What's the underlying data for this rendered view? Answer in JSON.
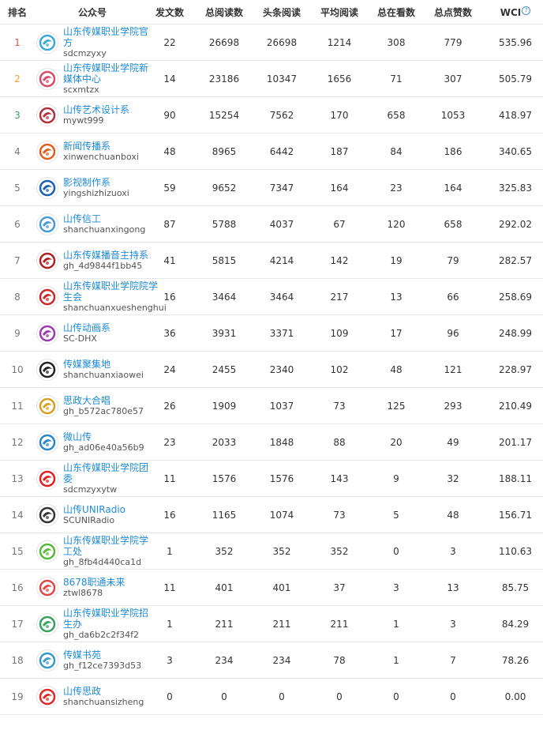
{
  "columns": {
    "rank": "排名",
    "account": "公众号",
    "posts": "发文数",
    "total_reads": "总阅读数",
    "headline_reads": "头条阅读",
    "avg_reads": "平均阅读",
    "total_watching": "总在看数",
    "total_likes": "总点赞数",
    "wci": "WCI",
    "wci_help_icon": "?"
  },
  "rows": [
    {
      "rank": "1",
      "title": "山东传媒职业学院官方",
      "id": "sdcmzyxy",
      "posts": "22",
      "total_reads": "26698",
      "headline_reads": "26698",
      "avg_reads": "1214",
      "total_watching": "308",
      "total_likes": "779",
      "wci": "535.96",
      "icon": "swirl-logo-icon",
      "color": "#3aa8d8"
    },
    {
      "rank": "2",
      "title": "山东传媒职业学院新媒体中心",
      "id": "scxmtzx",
      "posts": "14",
      "total_reads": "23186",
      "headline_reads": "10347",
      "avg_reads": "1656",
      "total_watching": "71",
      "total_likes": "307",
      "wci": "505.79",
      "icon": "pinwheel-logo-icon",
      "color": "#d84a6a"
    },
    {
      "rank": "3",
      "title": "山传艺术设计系",
      "id": "mywt999",
      "posts": "90",
      "total_reads": "15254",
      "headline_reads": "7562",
      "avg_reads": "170",
      "total_watching": "658",
      "total_likes": "1053",
      "wci": "418.97",
      "icon": "art-seal-icon",
      "color": "#b03040"
    },
    {
      "rank": "4",
      "title": "新闻传播系",
      "id": "xinwenchuanboxi",
      "posts": "48",
      "total_reads": "8965",
      "headline_reads": "6442",
      "avg_reads": "187",
      "total_watching": "84",
      "total_likes": "186",
      "wci": "340.65",
      "icon": "news-badge-icon",
      "color": "#e06020"
    },
    {
      "rank": "5",
      "title": "影视制作系",
      "id": "yingshizhizuoxi",
      "posts": "59",
      "total_reads": "9652",
      "headline_reads": "7347",
      "avg_reads": "164",
      "total_watching": "23",
      "total_likes": "164",
      "wci": "325.83",
      "icon": "film-badge-icon",
      "color": "#1a5fb4"
    },
    {
      "rank": "6",
      "title": "山传信工",
      "id": "shanchuanxingong",
      "posts": "87",
      "total_reads": "5788",
      "headline_reads": "4037",
      "avg_reads": "67",
      "total_watching": "120",
      "total_likes": "658",
      "wci": "292.02",
      "icon": "globe-logo-icon",
      "color": "#4a9ad8"
    },
    {
      "rank": "7",
      "title": "山东传媒播音主持系",
      "id": "gh_4d9844f1bb45",
      "posts": "41",
      "total_reads": "5815",
      "headline_reads": "4214",
      "avg_reads": "142",
      "total_watching": "19",
      "total_likes": "79",
      "wci": "282.57",
      "icon": "broadcast-seal-icon",
      "color": "#b02020"
    },
    {
      "rank": "8",
      "title": "山东传媒职业学院院学生会",
      "id": "shanchuanxueshenghui",
      "posts": "16",
      "total_reads": "3464",
      "headline_reads": "3464",
      "avg_reads": "217",
      "total_watching": "13",
      "total_likes": "66",
      "wci": "258.69",
      "icon": "student-union-seal-icon",
      "color": "#c82828"
    },
    {
      "rank": "9",
      "title": "山传动画系",
      "id": "SC-DHX",
      "posts": "36",
      "total_reads": "3931",
      "headline_reads": "3371",
      "avg_reads": "109",
      "total_watching": "17",
      "total_likes": "96",
      "wci": "248.99",
      "icon": "animation-logo-icon",
      "color": "#9a3ab0"
    },
    {
      "rank": "10",
      "title": "传媒聚集地",
      "id": "shanchuanxiaowei",
      "posts": "24",
      "total_reads": "2455",
      "headline_reads": "2340",
      "avg_reads": "102",
      "total_watching": "48",
      "total_likes": "121",
      "wci": "228.97",
      "icon": "ink-circle-icon",
      "color": "#222222"
    },
    {
      "rank": "11",
      "title": "思政大合唱",
      "id": "gh_b572ac780e57",
      "posts": "26",
      "total_reads": "1909",
      "headline_reads": "1037",
      "avg_reads": "73",
      "total_watching": "125",
      "total_likes": "293",
      "wci": "210.49",
      "icon": "choir-badge-icon",
      "color": "#d8a020"
    },
    {
      "rank": "12",
      "title": "微山传",
      "id": "gh_ad06e40a56b9",
      "posts": "23",
      "total_reads": "2033",
      "headline_reads": "1848",
      "avg_reads": "88",
      "total_watching": "20",
      "total_likes": "49",
      "wci": "201.17",
      "icon": "swirl-logo-icon",
      "color": "#2a88c8"
    },
    {
      "rank": "13",
      "title": "山东传媒职业学院团委",
      "id": "sdcmzyxytw",
      "posts": "11",
      "total_reads": "1576",
      "headline_reads": "1576",
      "avg_reads": "143",
      "total_watching": "9",
      "total_likes": "32",
      "wci": "188.11",
      "icon": "youth-league-badge-icon",
      "color": "#e02020"
    },
    {
      "rank": "14",
      "title": "山传UNIRadio",
      "id": "SCUNIRadio",
      "posts": "16",
      "total_reads": "1165",
      "headline_reads": "1074",
      "avg_reads": "73",
      "total_watching": "5",
      "total_likes": "48",
      "wci": "156.71",
      "icon": "radio-logo-icon",
      "color": "#333333"
    },
    {
      "rank": "15",
      "title": "山东传媒职业学院学工处",
      "id": "gh_8fb4d440ca1d",
      "posts": "1",
      "total_reads": "352",
      "headline_reads": "352",
      "avg_reads": "352",
      "total_watching": "0",
      "total_likes": "3",
      "wci": "110.63",
      "icon": "leaf-logo-icon",
      "color": "#58b838"
    },
    {
      "rank": "16",
      "title": "8678职通未来",
      "id": "ztwl8678",
      "posts": "11",
      "total_reads": "401",
      "headline_reads": "401",
      "avg_reads": "37",
      "total_watching": "3",
      "total_likes": "13",
      "wci": "85.75",
      "icon": "starburst-logo-icon",
      "color": "#e04848"
    },
    {
      "rank": "17",
      "title": "山东传媒职业学院招生办",
      "id": "gh_da6b2c2f34f2",
      "posts": "1",
      "total_reads": "211",
      "headline_reads": "211",
      "avg_reads": "211",
      "total_watching": "1",
      "total_likes": "3",
      "wci": "84.29",
      "icon": "admissions-logo-icon",
      "color": "#38a060"
    },
    {
      "rank": "18",
      "title": "传媒书苑",
      "id": "gh_f12ce7393d53",
      "posts": "3",
      "total_reads": "234",
      "headline_reads": "234",
      "avg_reads": "78",
      "total_watching": "1",
      "total_likes": "7",
      "wci": "78.26",
      "icon": "book-logo-icon",
      "color": "#3a98c8"
    },
    {
      "rank": "19",
      "title": "山传思政",
      "id": "shanchuansizheng",
      "posts": "0",
      "total_reads": "0",
      "headline_reads": "0",
      "avg_reads": "0",
      "total_watching": "0",
      "total_likes": "0",
      "wci": "0.00",
      "icon": "heart-logo-icon",
      "color": "#e02828"
    }
  ]
}
